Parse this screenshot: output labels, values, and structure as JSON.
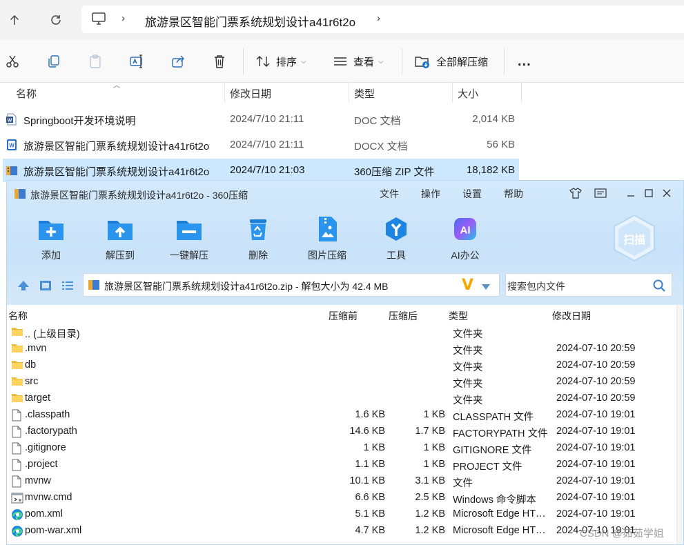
{
  "explorer": {
    "path": "旅游景区智能门票系统规划设计a41r6t2o",
    "nav_icons": [
      "up-arrow-icon",
      "refresh-icon",
      "monitor-icon"
    ],
    "toolbar": {
      "sort_label": "排序",
      "view_label": "查看",
      "extract_all_label": "全部解压缩",
      "more_label": "..."
    },
    "columns": {
      "name": "名称",
      "date": "修改日期",
      "type": "类型",
      "size": "大小"
    },
    "files": [
      {
        "name": "Springboot开发环境说明",
        "date": "2024/7/10 21:11",
        "type": "DOC 文档",
        "size": "2,014 KB",
        "icon": "word-doc-icon"
      },
      {
        "name": "旅游景区智能门票系统规划设计a41r6t2o",
        "date": "2024/7/10 21:11",
        "type": "DOCX 文档",
        "size": "56 KB",
        "icon": "word-docx-icon"
      },
      {
        "name": "旅游景区智能门票系统规划设计a41r6t2o",
        "date": "2024/7/10 21:03",
        "type": "360压缩 ZIP 文件",
        "size": "18,182 KB",
        "icon": "zip-archive-icon",
        "selected": true
      }
    ]
  },
  "zip": {
    "title": "旅游景区智能门票系统规划设计a41r6t2o - 360压缩",
    "menu": [
      "文件",
      "操作",
      "设置",
      "帮助"
    ],
    "tools": [
      {
        "label": "添加",
        "icon": "add-folder-icon"
      },
      {
        "label": "解压到",
        "icon": "extract-to-folder-icon"
      },
      {
        "label": "一键解压",
        "icon": "one-click-extract-icon"
      },
      {
        "label": "删除",
        "icon": "recycle-bin-icon"
      },
      {
        "label": "图片压缩",
        "icon": "image-compress-icon"
      },
      {
        "label": "工具",
        "icon": "tools-icon"
      },
      {
        "label": "AI办公",
        "icon": "ai-office-icon"
      }
    ],
    "scan_label": "扫描",
    "path_text": "旅游景区智能门票系统规划设计a41r6t2o.zip - 解包大小为 42.4 MB",
    "search_placeholder": "搜索包内文件",
    "columns": {
      "name": "名称",
      "before": "压缩前",
      "after": "压缩后",
      "type": "类型",
      "date": "修改日期"
    },
    "rows": [
      {
        "name": ".. (上级目录)",
        "before": "",
        "after": "",
        "type": "文件夹",
        "date": "",
        "icon": "folder-icon"
      },
      {
        "name": ".mvn",
        "before": "",
        "after": "",
        "type": "文件夹",
        "date": "2024-07-10 20:59",
        "icon": "folder-icon"
      },
      {
        "name": "db",
        "before": "",
        "after": "",
        "type": "文件夹",
        "date": "2024-07-10 20:59",
        "icon": "folder-icon"
      },
      {
        "name": "src",
        "before": "",
        "after": "",
        "type": "文件夹",
        "date": "2024-07-10 20:59",
        "icon": "folder-icon"
      },
      {
        "name": "target",
        "before": "",
        "after": "",
        "type": "文件夹",
        "date": "2024-07-10 20:59",
        "icon": "folder-icon"
      },
      {
        "name": ".classpath",
        "before": "1.6 KB",
        "after": "1 KB",
        "type": "CLASSPATH 文件",
        "date": "2024-07-10 19:01",
        "icon": "file-icon"
      },
      {
        "name": ".factorypath",
        "before": "14.6 KB",
        "after": "1.7 KB",
        "type": "FACTORYPATH 文件",
        "date": "2024-07-10 19:01",
        "icon": "file-icon"
      },
      {
        "name": ".gitignore",
        "before": "1 KB",
        "after": "1 KB",
        "type": "GITIGNORE 文件",
        "date": "2024-07-10 19:01",
        "icon": "file-icon"
      },
      {
        "name": ".project",
        "before": "1.1 KB",
        "after": "1 KB",
        "type": "PROJECT 文件",
        "date": "2024-07-10 19:01",
        "icon": "file-icon"
      },
      {
        "name": "mvnw",
        "before": "10.1 KB",
        "after": "3.1 KB",
        "type": "文件",
        "date": "2024-07-10 19:01",
        "icon": "file-icon"
      },
      {
        "name": "mvnw.cmd",
        "before": "6.6 KB",
        "after": "2.5 KB",
        "type": "Windows 命令脚本",
        "date": "2024-07-10 19:01",
        "icon": "cmd-script-icon"
      },
      {
        "name": "pom.xml",
        "before": "5.1 KB",
        "after": "1.2 KB",
        "type": "Microsoft Edge HTML Document",
        "date": "2024-07-10 19:01",
        "icon": "edge-icon"
      },
      {
        "name": "pom-war.xml",
        "before": "4.7 KB",
        "after": "1.2 KB",
        "type": "Microsoft Edge HTML Document",
        "date": "2024-07-10 19:01",
        "icon": "edge-icon"
      }
    ]
  },
  "watermark": "CSDN @茹茹学姐"
}
